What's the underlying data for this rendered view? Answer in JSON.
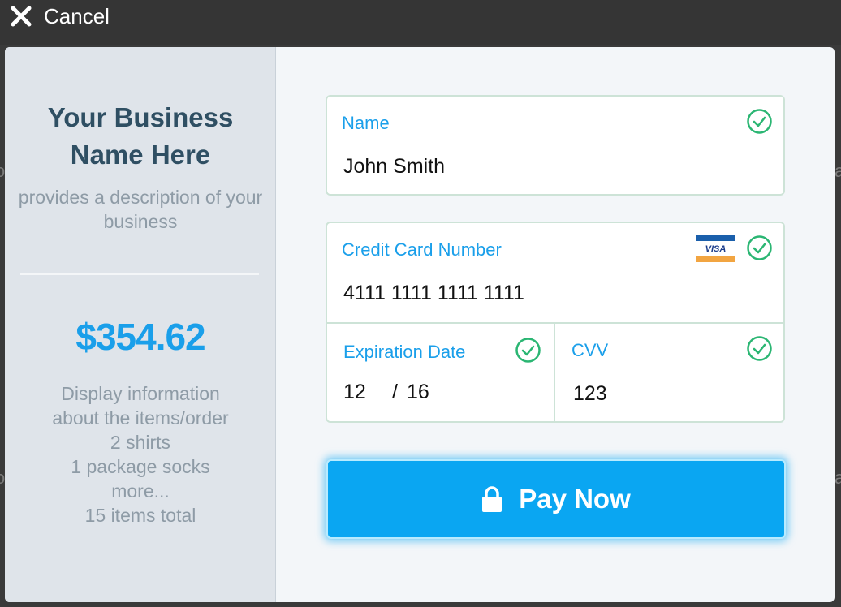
{
  "topbar": {
    "cancel_label": "Cancel"
  },
  "business": {
    "name": "Your Business Name Here",
    "description": "provides a description of your business"
  },
  "order": {
    "amount": "$354.62",
    "info_lines": [
      "Display information",
      "about the items/order",
      "2 shirts",
      "1 package socks",
      "more...",
      "15 items total"
    ]
  },
  "form": {
    "name": {
      "label": "Name",
      "value": "John Smith",
      "valid": true
    },
    "card_number": {
      "label": "Credit Card Number",
      "value": "4111 1111 1111 1111",
      "card_brand": "VISA",
      "valid": true
    },
    "expiration": {
      "label": "Expiration Date",
      "month": "12",
      "separator": "/",
      "year": "16",
      "valid": true
    },
    "cvv": {
      "label": "CVV",
      "value": "123",
      "valid": true
    }
  },
  "pay_button": {
    "label": "Pay Now",
    "icon": "lock-icon"
  },
  "colors": {
    "accent": "#1a9fea",
    "button": "#0aa6f2",
    "valid_check": "#2bb673",
    "sidebar_bg": "#dfe4ea",
    "business_name": "#2f4f63"
  }
}
